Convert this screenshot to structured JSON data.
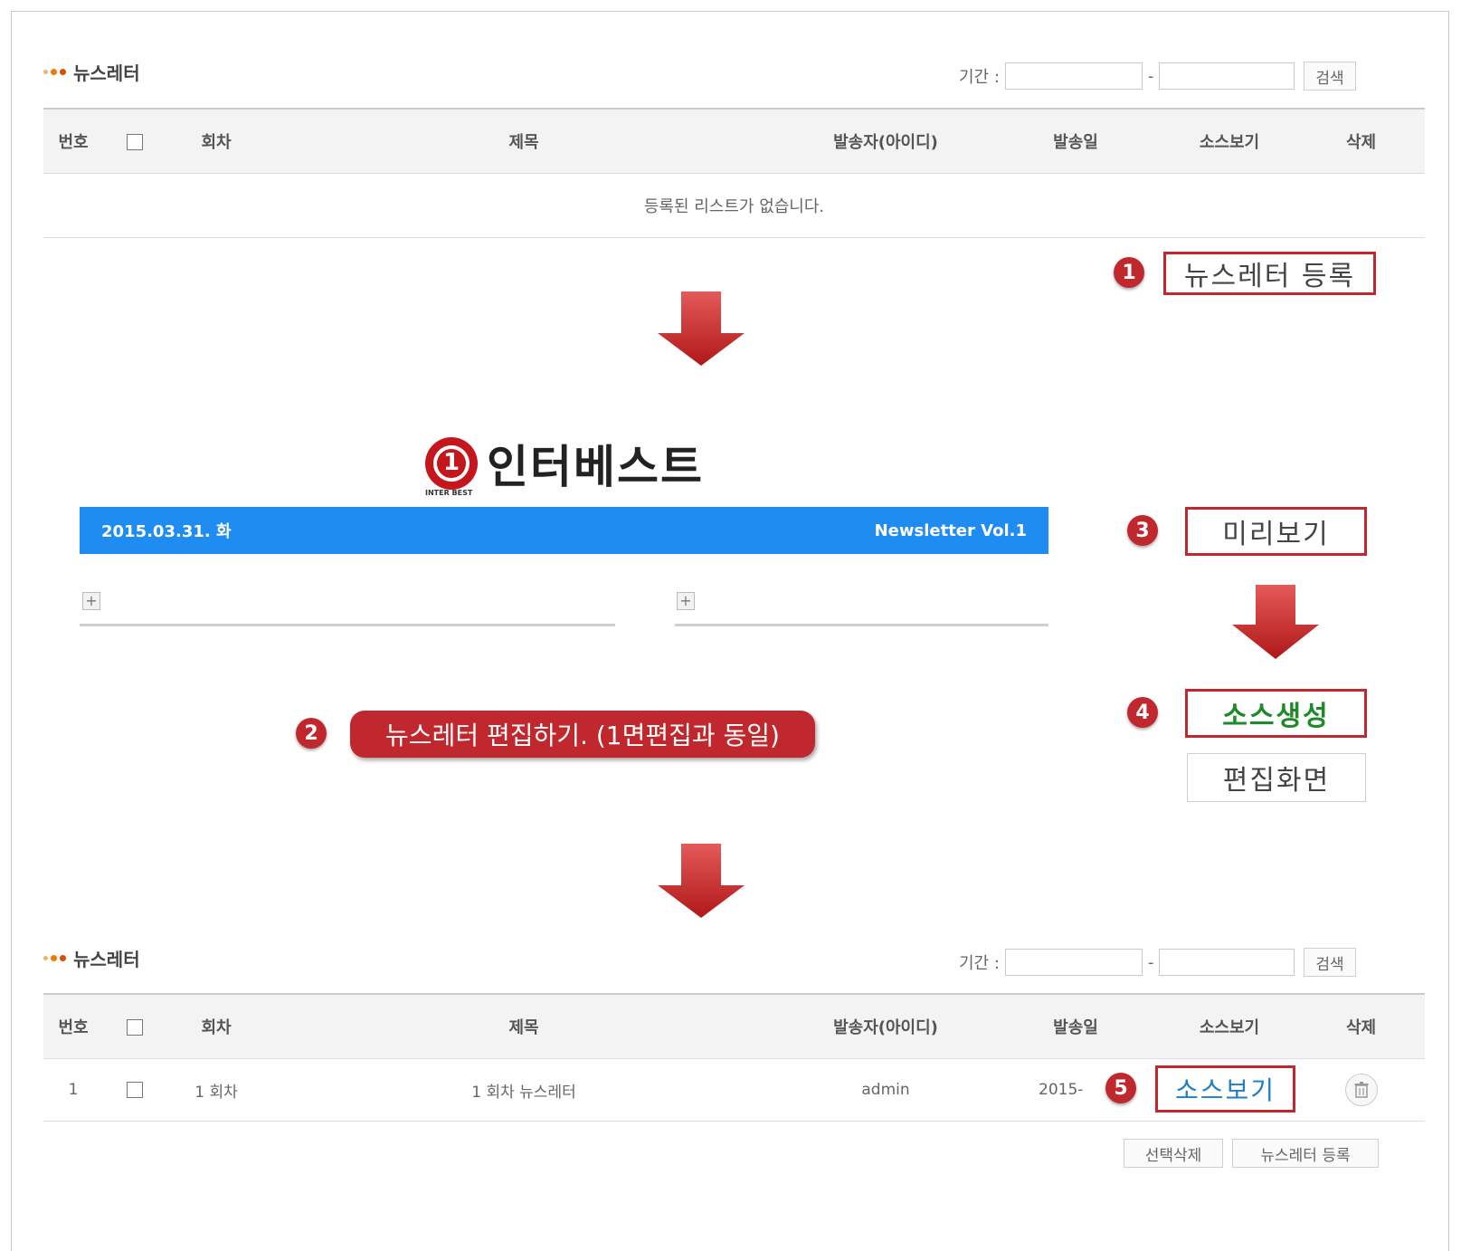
{
  "list_top": {
    "section_title": "뉴스레터",
    "period_label": "기간 :",
    "period_separator": "-",
    "search_button": "검색",
    "columns": [
      "번호",
      "회차",
      "제목",
      "발송자(아이디)",
      "발송일",
      "소스보기",
      "삭제"
    ],
    "empty_message": "등록된 리스트가 없습니다."
  },
  "register_button": "뉴스레터 등록",
  "editor": {
    "logo_text": "인터베스트",
    "logo_subtext": "INTER BEST",
    "date": "2015.03.31. 화",
    "volume": "Newsletter Vol.1",
    "edit_callout": "뉴스레터 편집하기. (1면편집과 동일)",
    "preview_button": "미리보기",
    "generate_button": "소스생성",
    "edit_screen_button": "편집화면"
  },
  "steps": [
    "1",
    "2",
    "3",
    "4",
    "5"
  ],
  "list_bottom": {
    "section_title": "뉴스레터",
    "period_label": "기간 :",
    "period_separator": "-",
    "search_button": "검색",
    "columns": [
      "번호",
      "회차",
      "제목",
      "발송자(아이디)",
      "발송일",
      "소스보기",
      "삭제"
    ],
    "row": {
      "number": "1",
      "round": "1 회차",
      "title": "1 회차 뉴스레터",
      "sender": "admin",
      "date": "2015-",
      "view_source": "소스보기"
    },
    "delete_selected_button": "선택삭제",
    "register_button": "뉴스레터 등록"
  },
  "colors": {
    "accent_red": "#c0282d",
    "bar_blue": "#1e8cf0",
    "link_blue": "#1d7fc4",
    "generate_green": "#1f8a2a"
  },
  "icons": [
    "trash-icon",
    "plus-icon",
    "down-arrow-icon",
    "checkbox-icon"
  ]
}
